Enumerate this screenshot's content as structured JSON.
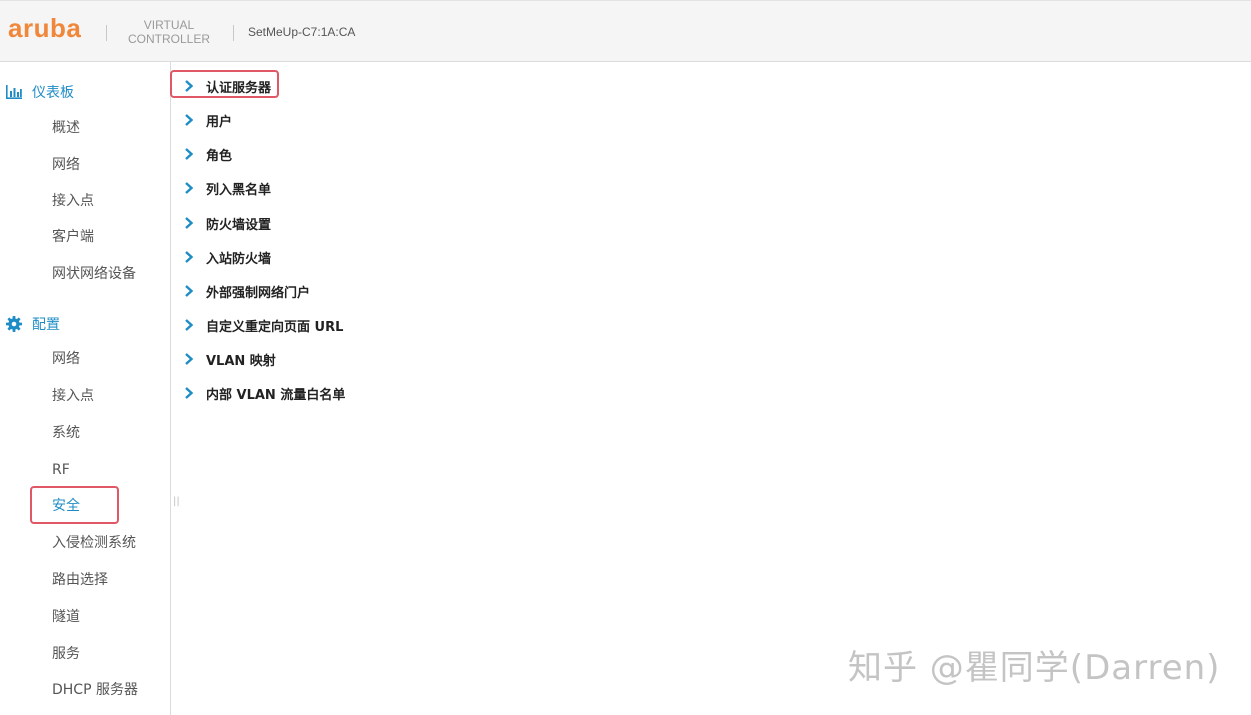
{
  "header": {
    "logo_text": "aruba",
    "product_line1": "VIRTUAL",
    "product_line2": "CONTROLLER",
    "device_name": "SetMeUp-C7:1A:CA"
  },
  "sidebar": {
    "dashboard": {
      "title": "仪表板",
      "icon": "bar-chart-icon",
      "items": [
        "概述",
        "网络",
        "接入点",
        "客户端",
        "网状网络设备"
      ]
    },
    "config": {
      "title": "配置",
      "icon": "gear-icon",
      "items": [
        "网络",
        "接入点",
        "系统",
        "RF",
        "安全",
        "入侵检测系统",
        "路由选择",
        "隧道",
        "服务",
        "DHCP 服务器"
      ],
      "active_item": "安全"
    }
  },
  "main": {
    "items": [
      "认证服务器",
      "用户",
      "角色",
      "列入黑名单",
      "防火墙设置",
      "入站防火墙",
      "外部强制网络门户",
      "自定义重定向页面 URL",
      "VLAN 映射",
      "内部 VLAN 流量白名单"
    ],
    "highlighted_item": "认证服务器"
  },
  "watermark": "知乎 @瞿同学(Darren)",
  "colors": {
    "brand_orange": "#f0873a",
    "accent_blue": "#1f8dc5",
    "highlight_red": "#e05765"
  }
}
